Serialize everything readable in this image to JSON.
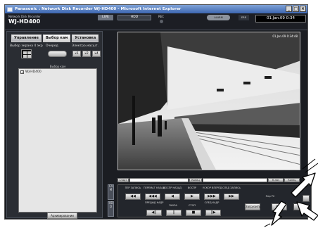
{
  "window": {
    "title": "Panasonic : Network Disk Recorder WJ-HD400 - Microsoft Internet Explorer",
    "buttons": [
      "_",
      "□",
      "×"
    ]
  },
  "header": {
    "product_sub": "Network Disk Recorder",
    "product_name": "WJ-HD400",
    "live_label": "LIVE",
    "hdd_label": "HDD",
    "rec_label": "REC",
    "alarm_label": "ALARM",
    "error_label": "ERR",
    "datetime": "01.Jan.09  0:34"
  },
  "left_panel": {
    "tabs": [
      {
        "label": "Управление"
      },
      {
        "label": "Выбор кам"
      },
      {
        "label": "Установка"
      }
    ],
    "split_label": "Выбор экрана 4 экр",
    "sequence_label": "Очеред",
    "zoom_label": "Электро.масшт.",
    "sequence_value": "",
    "zoom_buttons": [
      "x1",
      "x2",
      "x4"
    ],
    "camera_list_header": "Выбор кам",
    "camera_item": "WJ-HD400",
    "archive_button": "Архивировании"
  },
  "video": {
    "timestamp": "01.Jan.09  0:34:48"
  },
  "status_row": {
    "start_label": "Старт",
    "end_label": "Конец",
    "prev_label": "К-нач",
    "next_label": "Конец"
  },
  "side_tabs": {
    "cam_label": "CAM",
    "hdd_label": "HDD"
  },
  "controls": {
    "prev_record": "ПЕР ЗАПИСЬ",
    "rewind": "ПЕРЕМАТ НАЗАД",
    "reverse_play": "ВОСПР НАЗАД",
    "play": "ВОСПР",
    "fast_forward": "УСКОР ВПЕРЁД",
    "next_record": "СЛЕД ЗАПИСЬ",
    "prev_frame": "ПРЕДЫД КАДР",
    "pause": "ПАУЗА",
    "stop": "СТОП",
    "next_frame": "СЛЕД КАДР",
    "goto_last": "Пер РС",
    "download_button": "Загрузить",
    "goto_button": "Пуск",
    "zoom_label": "Зоом"
  }
}
